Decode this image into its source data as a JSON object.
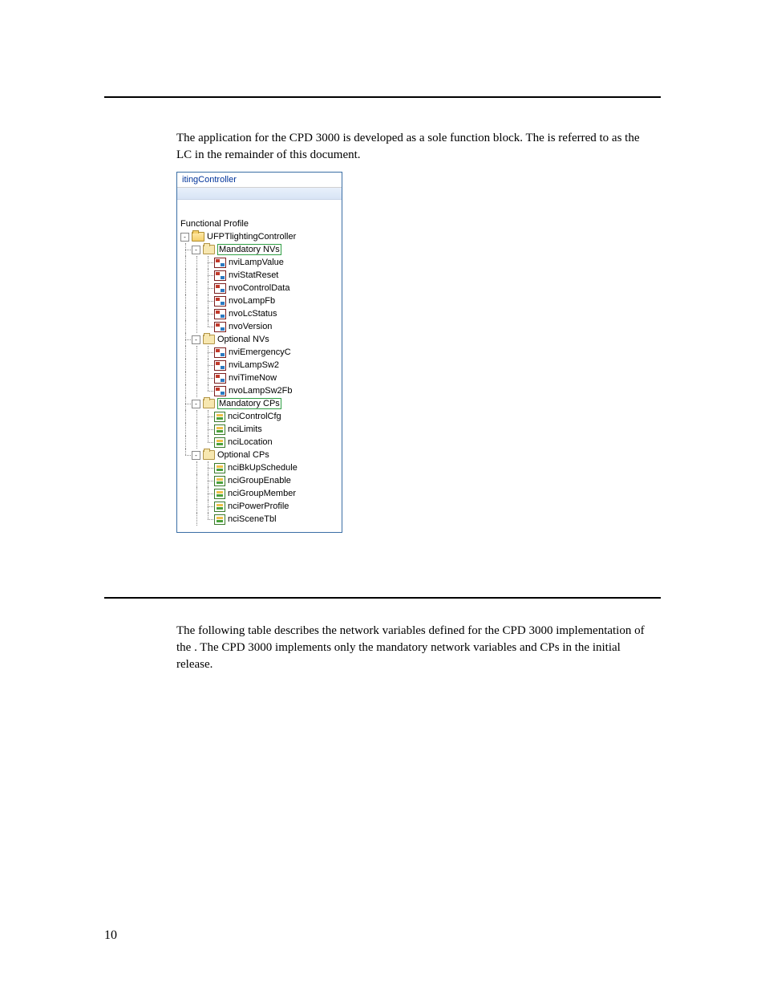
{
  "para1": "The application for the CPD 3000 is developed as a sole function block.  The",
  "para1b": " is referred to as the LC in the remainder of this document.",
  "para2": "The following table describes the network variables defined for the CPD 3000 implementation of the ",
  "para2b": ".  The CPD 3000 implements only the mandatory network variables and CPs in the initial release.",
  "pageNumber": "10",
  "tree": {
    "panelTitle": "itingController",
    "header": "Functional Profile",
    "root": "UFPTlightingController",
    "groups": [
      {
        "label": "Mandatory NVs",
        "type": "nv",
        "boxed": true,
        "items": [
          "nviLampValue",
          "nviStatReset",
          "nvoControlData",
          "nvoLampFb",
          "nvoLcStatus",
          "nvoVersion"
        ]
      },
      {
        "label": "Optional NVs",
        "type": "nv",
        "boxed": false,
        "items": [
          "nviEmergencyC",
          "nviLampSw2",
          "nviTimeNow",
          "nvoLampSw2Fb"
        ]
      },
      {
        "label": "Mandatory CPs",
        "type": "cp",
        "boxed": true,
        "items": [
          "nciControlCfg",
          "nciLimits",
          "nciLocation"
        ]
      },
      {
        "label": "Optional CPs",
        "type": "cp",
        "boxed": false,
        "items": [
          "nciBkUpSchedule",
          "nciGroupEnable",
          "nciGroupMember",
          "nciPowerProfile",
          "nciSceneTbl"
        ]
      }
    ]
  }
}
